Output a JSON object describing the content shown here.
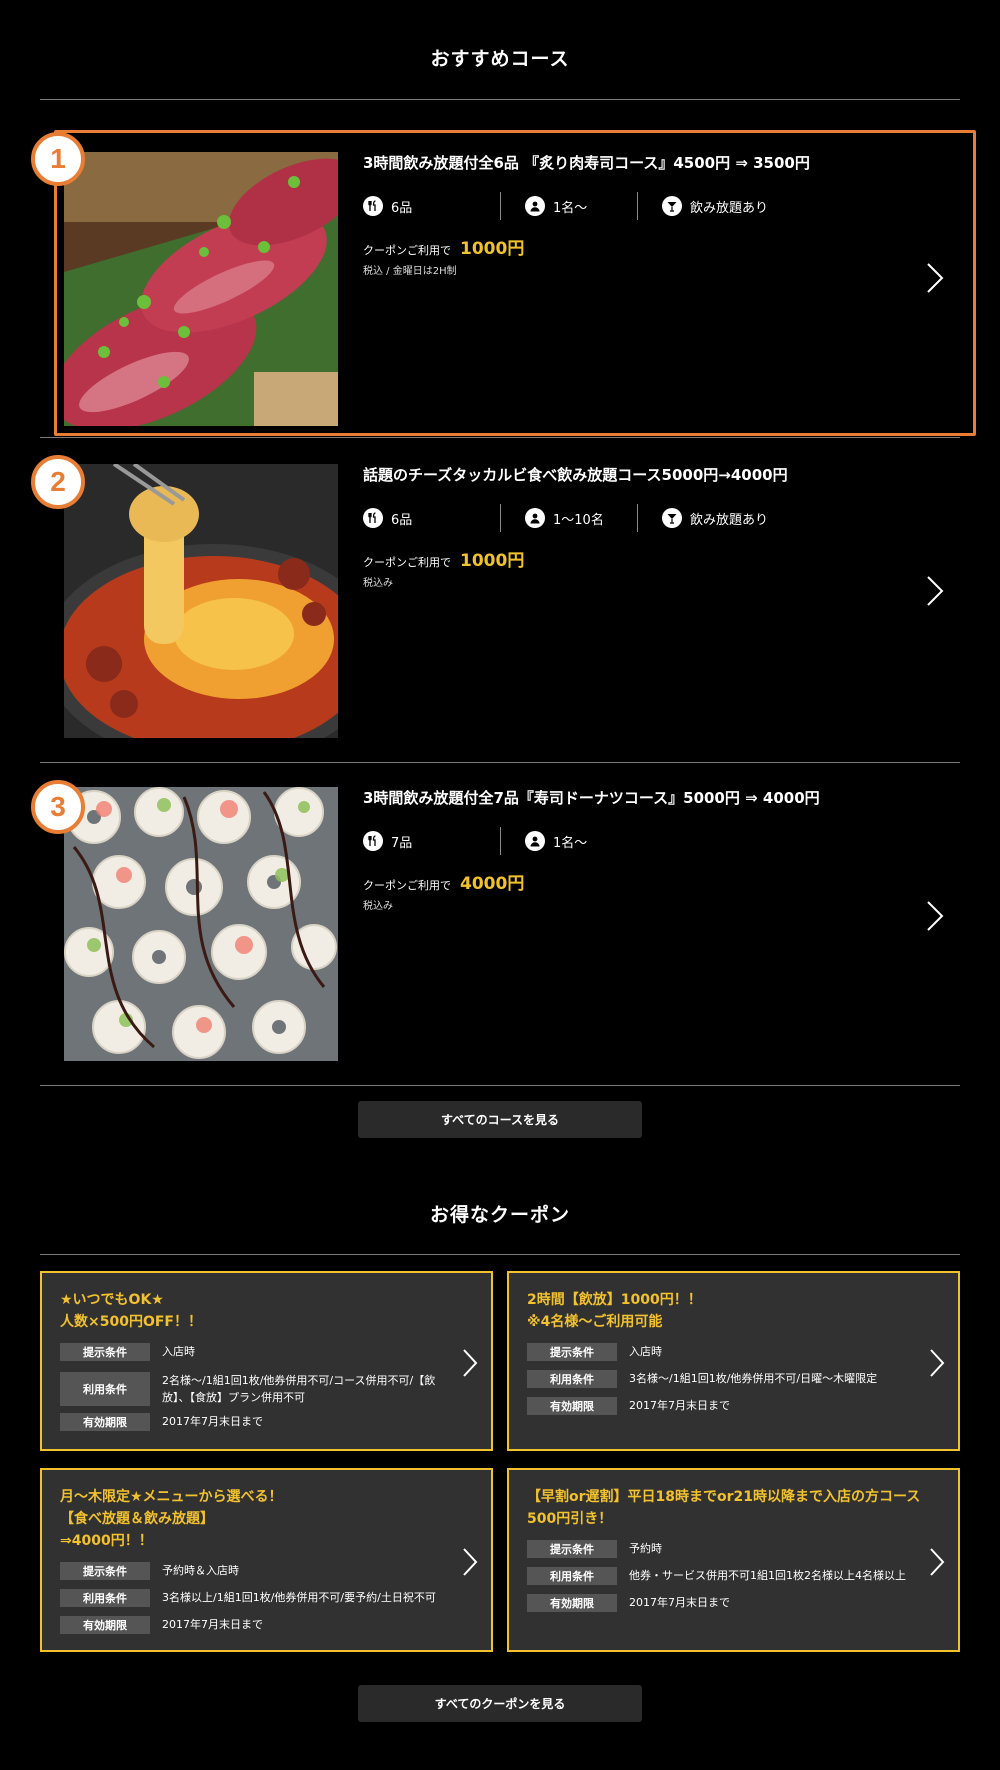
{
  "courses_section": {
    "title": "おすすめコース",
    "courses": [
      {
        "rank": "1",
        "title": "3時間飲み放題付全6品 『炙り肉寿司コース』4500円 ⇒ 3500円",
        "dishes": "6品",
        "people": "1名～",
        "drink": "飲み放題あり",
        "coupon_label": "クーポンご利用で",
        "coupon_price": "1000円",
        "note": "税込 / 金曜日は2H制"
      },
      {
        "rank": "2",
        "title": "話題のチーズタッカルビ食べ飲み放題コース5000円→4000円",
        "dishes": "6品",
        "people": "1～10名",
        "drink": "飲み放題あり",
        "coupon_label": "クーポンご利用で",
        "coupon_price": "1000円",
        "note": "税込み"
      },
      {
        "rank": "3",
        "title": "3時間飲み放題付全7品『寿司ドーナツコース』5000円 ⇒ 4000円",
        "dishes": "7品",
        "people": "1名～",
        "coupon_label": "クーポンご利用で",
        "coupon_price": "4000円",
        "note": "税込み"
      }
    ],
    "all_button": "すべてのコースを見る"
  },
  "coupons_section": {
    "title": "お得なクーポン",
    "coupons": [
      {
        "title_lines": [
          "★いつでもOK★",
          "人数×500円OFF！！"
        ],
        "rows": [
          {
            "key": "提示条件",
            "value": "入店時"
          },
          {
            "key": "利用条件",
            "value": "2名様～/1組1回1枚/他券併用不可/コース併用不可/【飲放】、【食放】プラン併用不可"
          },
          {
            "key": "有効期限",
            "value": "2017年7月末日まで"
          }
        ]
      },
      {
        "title_lines": [
          "2時間【飲放】1000円！！",
          "※4名様～ご利用可能"
        ],
        "rows": [
          {
            "key": "提示条件",
            "value": "入店時"
          },
          {
            "key": "利用条件",
            "value": "3名様～/1組1回1枚/他券併用不可/日曜～木曜限定"
          },
          {
            "key": "有効期限",
            "value": "2017年7月末日まで"
          }
        ]
      },
      {
        "title_lines": [
          "月～木限定★メニューから選べる！",
          "【食べ放題＆飲み放題】",
          "⇒4000円！！"
        ],
        "rows": [
          {
            "key": "提示条件",
            "value": "予約時＆入店時"
          },
          {
            "key": "利用条件",
            "value": "3名様以上/1組1回1枚/他券併用不可/要予約/土日祝不可"
          },
          {
            "key": "有効期限",
            "value": "2017年7月末日まで"
          }
        ]
      },
      {
        "title_lines": [
          "【早割or遅割】平日18時までor21時以降まで入店の方コース",
          "500円引き！"
        ],
        "rows": [
          {
            "key": "提示条件",
            "value": "予約時"
          },
          {
            "key": "利用条件",
            "value": "他券・サービス併用不可1組1回1枚2名様以上4名様以上"
          },
          {
            "key": "有効期限",
            "value": "2017年7月末日まで"
          }
        ]
      }
    ],
    "all_button": "すべてのクーポンを見る"
  },
  "colors": {
    "accent_orange": "#e87d35",
    "price_yellow": "#f2c12e",
    "coupon_bg": "#313131"
  },
  "icons": [
    "fork-knife-icon",
    "person-icon",
    "cocktail-icon",
    "chevron-right-icon"
  ]
}
